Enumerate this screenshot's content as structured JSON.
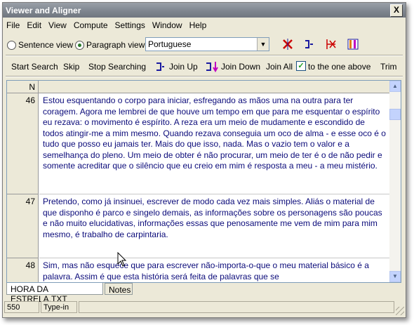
{
  "window": {
    "title": "Viewer and Aligner",
    "close_label": "X"
  },
  "menu": [
    "File",
    "Edit",
    "View",
    "Compute",
    "Settings",
    "Window",
    "Help"
  ],
  "view_mode": {
    "sentence_label": "Sentence view",
    "paragraph_label": "Paragraph view",
    "selected": "paragraph"
  },
  "language_select": {
    "value": "Portuguese"
  },
  "toolbar_icons": [
    "cut-link-icon",
    "join-icon",
    "delete-marker-icon",
    "columns-icon"
  ],
  "toolbar2": {
    "start_search": "Start Search",
    "skip": "Skip",
    "stop_searching": "Stop Searching",
    "join_up": "Join Up",
    "join_down": "Join Down",
    "join_all": "Join All",
    "to_one_above": "to the one above",
    "to_one_above_checked": true,
    "trim": "Trim"
  },
  "grid": {
    "header_n": "N",
    "rows": [
      {
        "n": "46",
        "text": "Estou esquentando o corpo para iniciar, esfregando as mãos uma na outra para ter coragem. Agora me lembrei de que houve um tempo em que para me esquentar o espírito eu rezava: o movimento é espírito. A reza era um meio de mudamente e escondido de todos atingir-me a mim mesmo. Quando rezava conseguia um oco de alma - e esse oco é o tudo que posso eu jamais ter. Mais do que isso, nada. Mas o vazio tem o valor e a semelhança do pleno. Um meio de obter é não procurar, um meio de ter é o de não pedir e somente acreditar que o silêncio que eu creio em mim é resposta a meu - a meu mistério."
      },
      {
        "n": "47",
        "text": "Pretendo, como já insinuei, escrever de modo cada vez mais simples. Aliás o material de que disponho é parco e singelo demais, as informações sobre os personagens são poucas e não muito elucidativas, informações essas que penosamente me vem de mim para mim mesmo, é trabalho de carpintaria."
      },
      {
        "n": "48",
        "text": "Sim, mas não esquece que para escrever não-importa-o-que o meu material básico é a palavra. Assim é que esta história será feita de palavras que se"
      }
    ]
  },
  "tabs": [
    {
      "label": "HORA DA ESTRELA.TXT",
      "active": true
    },
    {
      "label": "Notes",
      "active": false
    }
  ],
  "status": {
    "count": "550",
    "mode": "Type-in"
  },
  "colors": {
    "row_text": "#0b0b7a",
    "accent_red": "#cc0000",
    "accent_blue": "#1a1aa0",
    "accent_magenta": "#c000c0"
  }
}
